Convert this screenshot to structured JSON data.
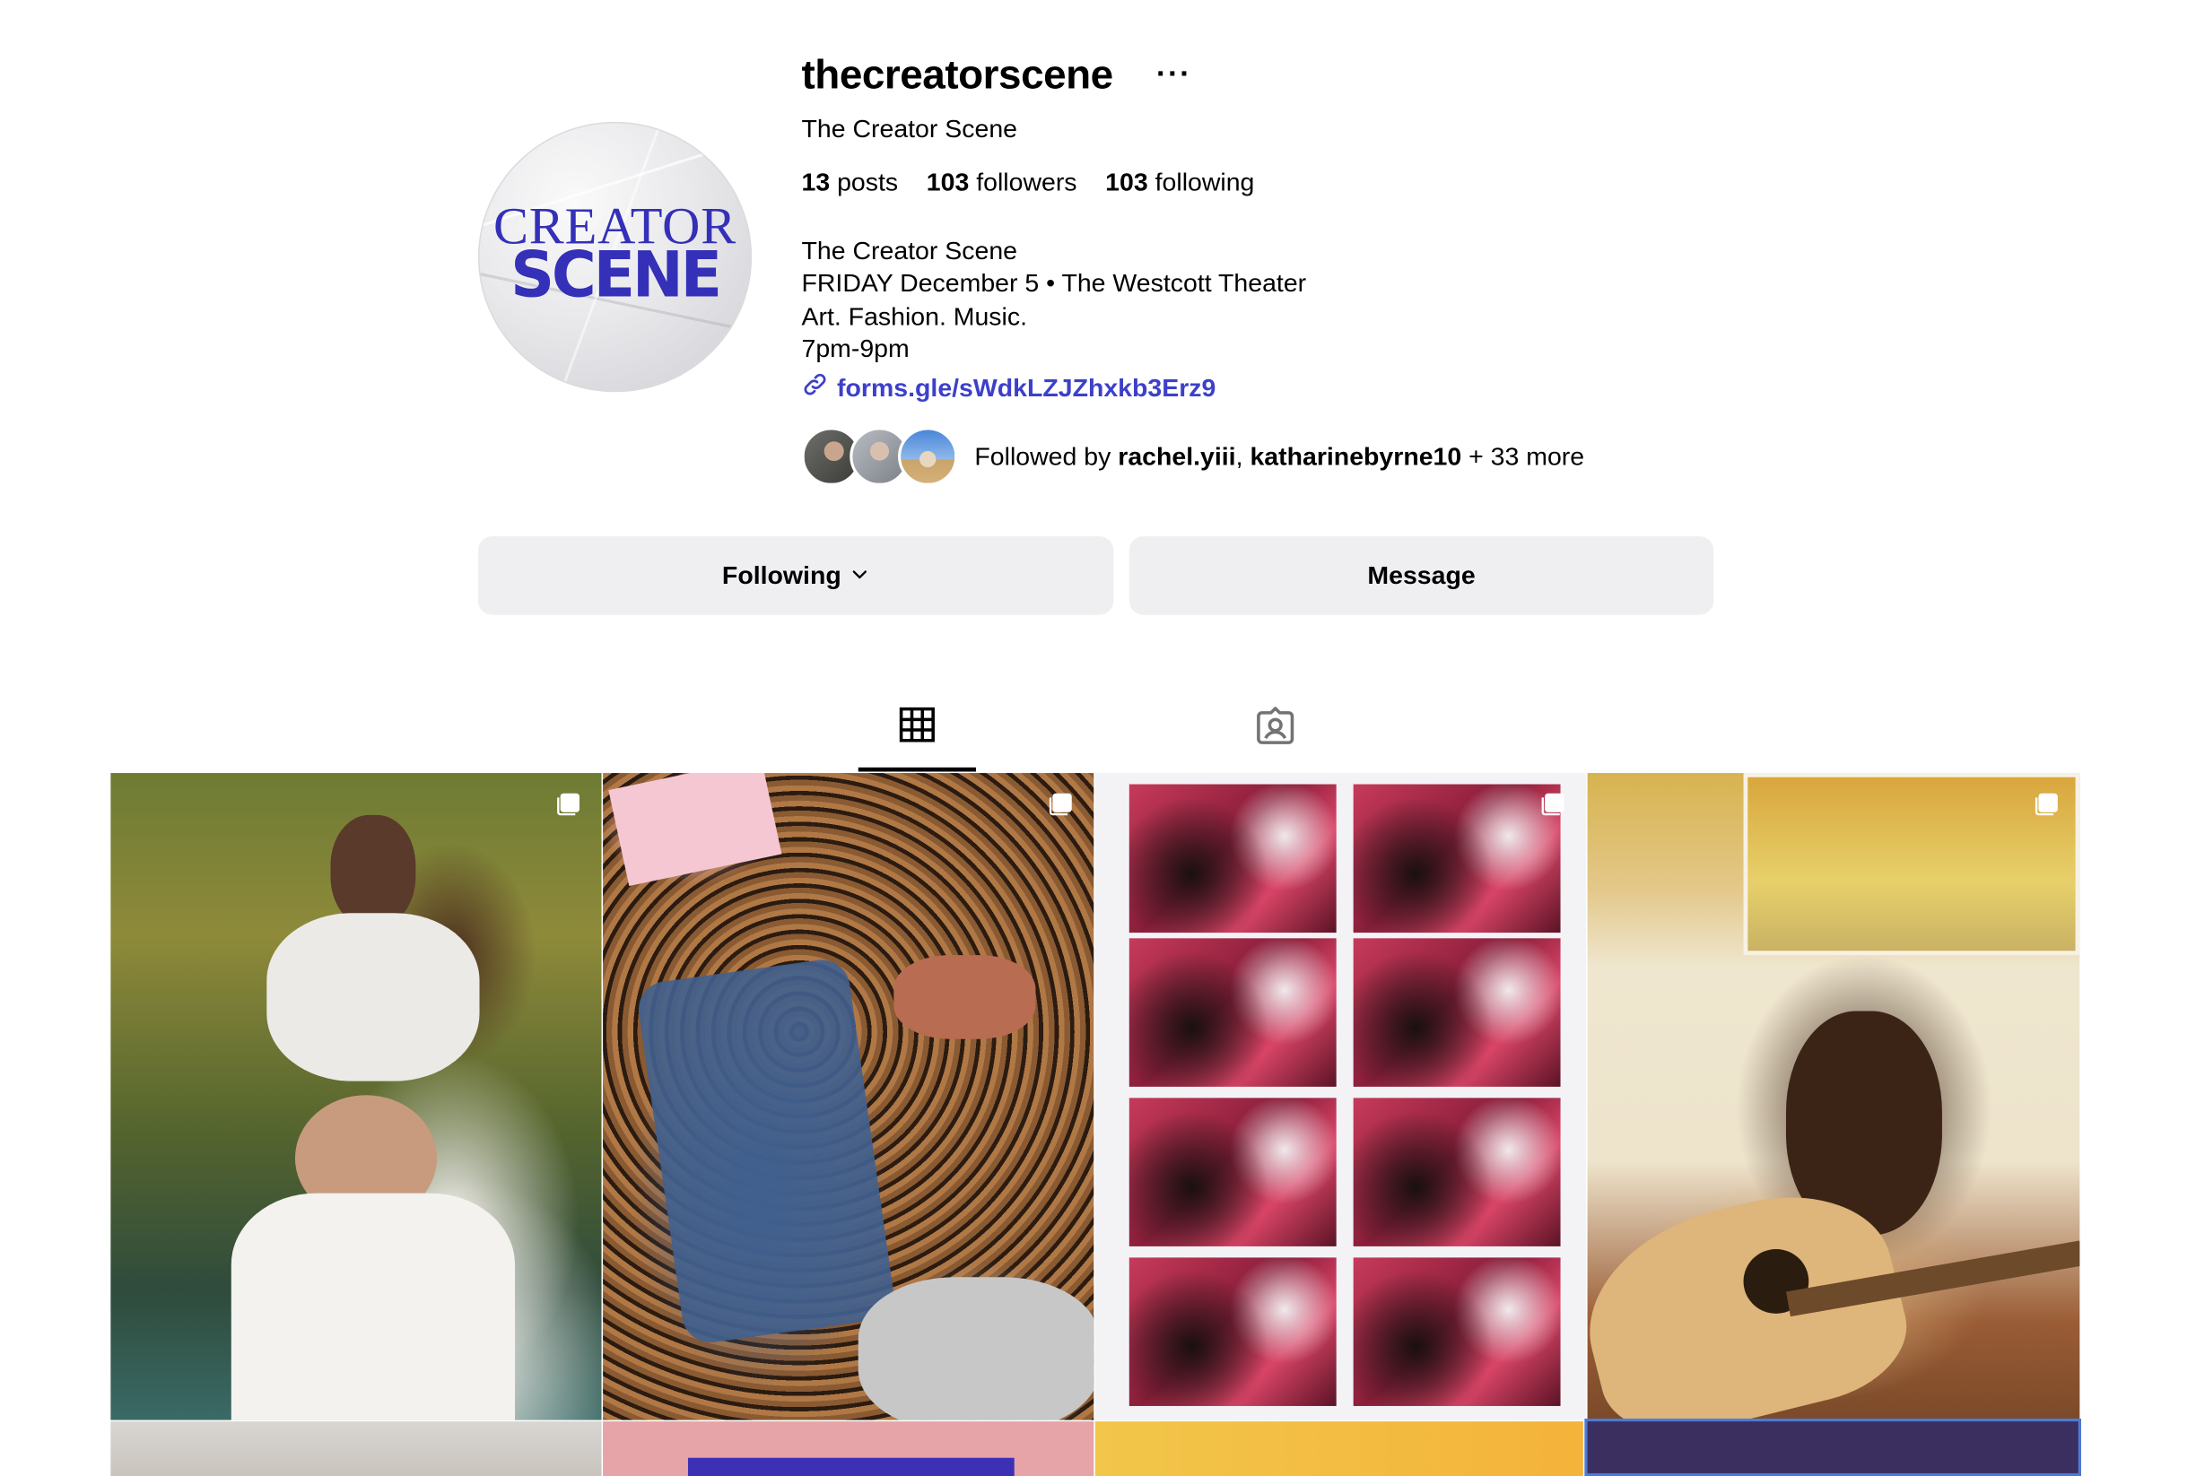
{
  "profile": {
    "username": "thecreatorscene",
    "more_label": "···",
    "full_name": "The Creator Scene",
    "avatar_logo": {
      "line1": "CREATOR",
      "line2": "SCENE",
      "color": "#3430b8"
    },
    "stats": {
      "posts_count": "13",
      "posts_label": "posts",
      "followers_count": "103",
      "followers_label": "followers",
      "following_count": "103",
      "following_label": "following"
    },
    "bio_lines": [
      "The Creator Scene",
      "FRIDAY December 5 • The Westcott Theater",
      "Art. Fashion. Music.",
      "7pm-9pm"
    ],
    "link": "forms.gle/sWdkLZJZhxkb3Erz9",
    "followed_by": {
      "prefix": "Followed by",
      "user1": "rachel.yiii",
      "separator": ",",
      "user2": "katharinebyrne10",
      "suffix": "+ 33 more"
    }
  },
  "actions": {
    "following_label": "Following",
    "message_label": "Message"
  },
  "tabs": [
    {
      "name": "posts-grid",
      "icon": "grid-icon",
      "active": true
    },
    {
      "name": "tagged",
      "icon": "tagged-person-icon",
      "active": false
    }
  ],
  "colors": {
    "link": "#3d40c9",
    "button_bg": "#efeff2",
    "text": "#000000"
  },
  "posts": [
    {
      "kind": "photo",
      "multi": true
    },
    {
      "kind": "photo",
      "multi": true
    },
    {
      "kind": "photo",
      "multi": true
    },
    {
      "kind": "photo",
      "multi": true
    },
    {
      "kind": "photo",
      "multi": false
    },
    {
      "kind": "photo",
      "multi": false
    },
    {
      "kind": "photo",
      "multi": false
    },
    {
      "kind": "photo",
      "multi": false
    }
  ]
}
